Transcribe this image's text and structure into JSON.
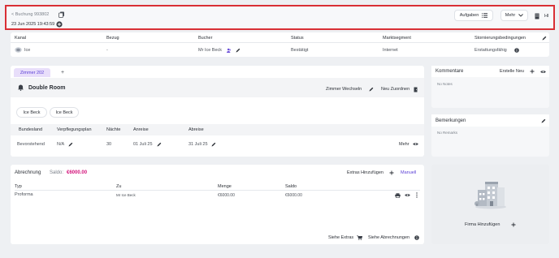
{
  "header": {
    "booking_label": "< Buchung 993802",
    "datetime": "23 Jun 2025 19:43:59",
    "tasks_label": "Aufgaben",
    "more_label": "Mehr",
    "user_initials": "HI"
  },
  "booking_table": {
    "columns": [
      "Kanal",
      "Bezug",
      "Bucher",
      "Status",
      "Marktsegment",
      "Stornierungsbedingungen"
    ],
    "row": {
      "kanal": "Ice",
      "bezug": "-",
      "bucher": "Mr Ice Beck",
      "status": "Bestätigt",
      "marktsegment": "Internet",
      "storno": "Erstattungsfähig"
    }
  },
  "room": {
    "tab_label": "Zimmer 202",
    "add_tab": "+",
    "room_type": "Double Room",
    "change_room": "Zimmer Wechseln",
    "reassign": "Neu Zuordnen",
    "guests": [
      "Ice Beck",
      "Ice Beck"
    ],
    "columns": [
      "Bundesland",
      "Verpflegungsplan",
      "Nächte",
      "Anreise",
      "Abreise"
    ],
    "row": {
      "bundesland": "Bevorstehend",
      "verpflegung": "N/A",
      "naechte": "30",
      "anreise": "01 Juli 25",
      "abreise": "31 Juli 25",
      "mehr": "Mehr"
    }
  },
  "billing": {
    "title": "Abrechnung",
    "saldo_label": "Saldo:",
    "saldo_value": "€6000.00",
    "add_extras": "Extras Hinzufügen",
    "manual": "Manuell",
    "columns": [
      "Typ",
      "Zu",
      "Menge",
      "Saldo"
    ],
    "row": {
      "typ": "Proforma",
      "zu": "Mr Ice Beck",
      "menge": "€6000.00",
      "saldo": "€6000.00"
    },
    "see_extras": "Siehe Extras",
    "see_bills": "Siehe Abrechnungen"
  },
  "comments": {
    "title": "Kommentare",
    "create_label": "Erstelle Neu",
    "empty": "No Notes"
  },
  "remarks": {
    "title": "Bemerkungen",
    "empty": "No Remarks"
  },
  "company": {
    "add_label": "Firma Hinzufügen"
  },
  "colors": {
    "accent": "#d3117a",
    "highlight_border": "#d92f35",
    "tab_active_bg": "#e8defa",
    "manual_link": "#5b3fd6"
  }
}
